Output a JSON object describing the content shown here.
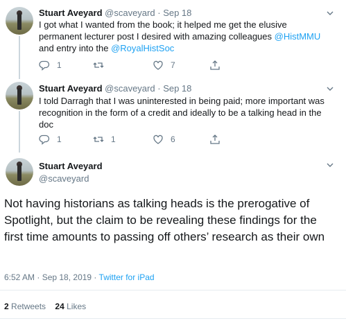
{
  "tweets": [
    {
      "name": "Stuart Aveyard",
      "handle": "@scaveyard",
      "sep": "·",
      "date": "Sep 18",
      "text_parts": [
        "I got what I wanted from the book; it helped me get the elusive permanent lecturer post I desired with amazing colleagues ",
        "@HistMMU",
        " and entry into the ",
        "@RoyalHistSoc"
      ],
      "replies": "1",
      "retweets": "",
      "likes": "7"
    },
    {
      "name": "Stuart Aveyard",
      "handle": "@scaveyard",
      "sep": "·",
      "date": "Sep 18",
      "text": "I told Darragh that I was uninterested in being paid; more important was recognition in the form of a credit and ideally to be a talking head in the doc",
      "replies": "1",
      "retweets": "1",
      "likes": "6"
    }
  ],
  "main": {
    "name": "Stuart Aveyard",
    "handle": "@scaveyard",
    "text": "Not having historians as talking heads is the prerogative of Spotlight, but the claim to be revealing these findings for the first time amounts to passing off others’ research as their own",
    "timestamp": "6:52 AM · Sep 18, 2019 · ",
    "source": "Twitter for iPad",
    "retweets_count": "2",
    "retweets_label": "Retweets",
    "likes_count": "24",
    "likes_label": "Likes"
  },
  "colors": {
    "link": "#1da1f2",
    "secondary_text": "#657786"
  },
  "icons": [
    "reply-icon",
    "retweet-icon",
    "like-icon",
    "share-icon",
    "chevron-down-icon"
  ]
}
